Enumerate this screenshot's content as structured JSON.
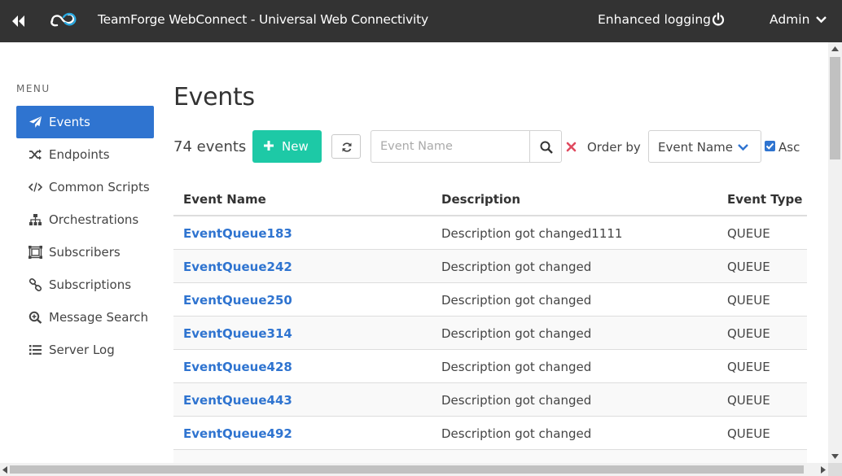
{
  "topbar": {
    "title": "TeamForge WebConnect - Universal Web Connectivity",
    "enhanced_logging": "Enhanced logging",
    "user": "Admin",
    "background": "#333333"
  },
  "sidebar": {
    "menu_label": "MENU",
    "items": [
      {
        "label": "Events",
        "icon": "paper-plane-icon",
        "active": true
      },
      {
        "label": "Endpoints",
        "icon": "shuffle-icon",
        "active": false
      },
      {
        "label": "Common Scripts",
        "icon": "code-icon",
        "active": false
      },
      {
        "label": "Orchestrations",
        "icon": "sitemap-icon",
        "active": false
      },
      {
        "label": "Subscribers",
        "icon": "object-group-icon",
        "active": false
      },
      {
        "label": "Subscriptions",
        "icon": "link-icon",
        "active": false
      },
      {
        "label": "Message Search",
        "icon": "search-plus-icon",
        "active": false
      },
      {
        "label": "Server Log",
        "icon": "list-icon",
        "active": false
      }
    ],
    "accent": "#2f74d0"
  },
  "main": {
    "title": "Events",
    "count_number": "74",
    "count_unit": "events",
    "new_button": "New",
    "new_button_color": "#1dc9a6",
    "search_placeholder": "Event Name",
    "search_value": "",
    "order_by_label": "Order by",
    "order_by_value": "Event Name",
    "asc_label": "Asc",
    "asc_checked": true
  },
  "table": {
    "headers": [
      "Event Name",
      "Description",
      "Event Type"
    ],
    "rows": [
      {
        "name": "EventQueue183",
        "description": "Description got changed1111",
        "type": "QUEUE"
      },
      {
        "name": "EventQueue242",
        "description": "Description got changed",
        "type": "QUEUE"
      },
      {
        "name": "EventQueue250",
        "description": "Description got changed",
        "type": "QUEUE"
      },
      {
        "name": "EventQueue314",
        "description": "Description got changed",
        "type": "QUEUE"
      },
      {
        "name": "EventQueue428",
        "description": "Description got changed",
        "type": "QUEUE"
      },
      {
        "name": "EventQueue443",
        "description": "Description got changed",
        "type": "QUEUE"
      },
      {
        "name": "EventQueue492",
        "description": "Description got changed",
        "type": "QUEUE"
      }
    ],
    "link_color": "#2f74d0"
  }
}
